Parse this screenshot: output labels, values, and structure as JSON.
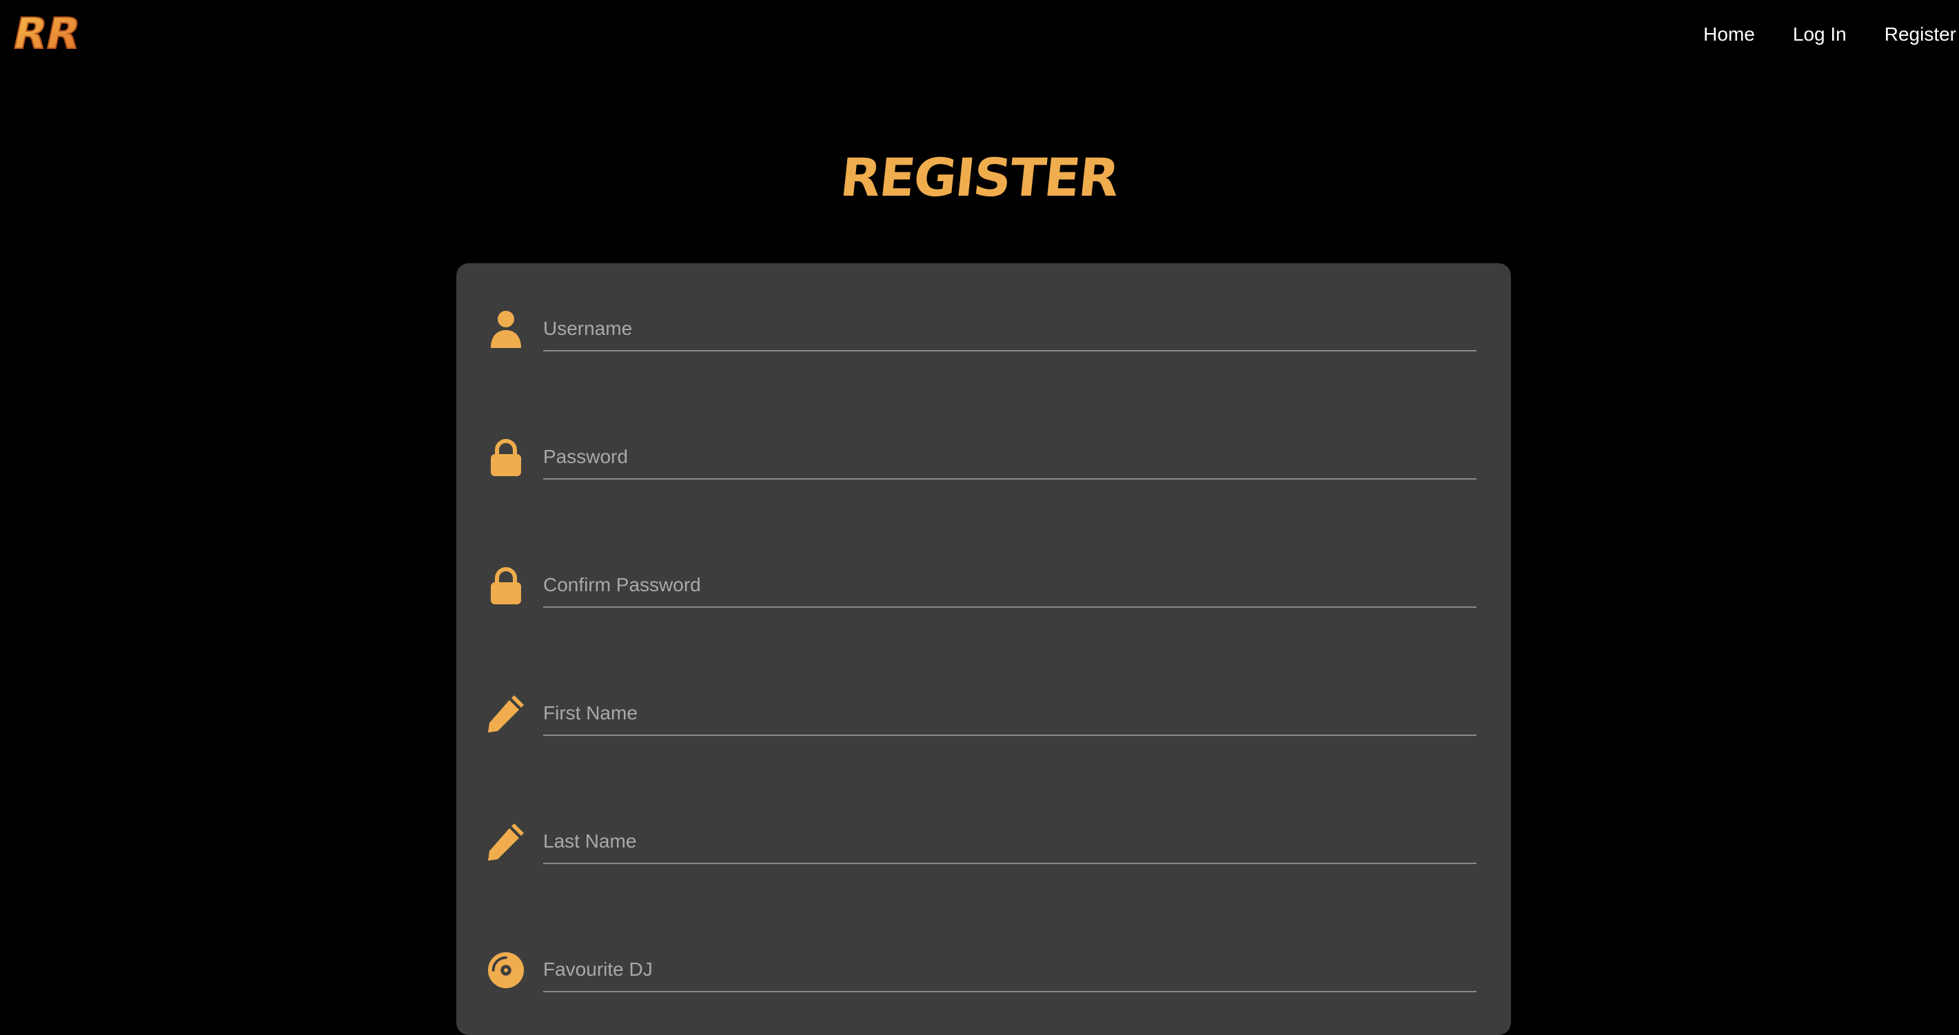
{
  "brand": {
    "logo_text": "RR",
    "accent_color": "#f0ad4e",
    "logo_color_dark": "#e0742a"
  },
  "nav": {
    "items": [
      {
        "label": "Home"
      },
      {
        "label": "Log In"
      },
      {
        "label": "Register"
      }
    ]
  },
  "page": {
    "title": "REGISTER"
  },
  "form": {
    "fields": [
      {
        "placeholder": "Username",
        "value": "",
        "icon": "user-icon"
      },
      {
        "placeholder": "Password",
        "value": "",
        "icon": "lock-icon"
      },
      {
        "placeholder": "Confirm Password",
        "value": "",
        "icon": "lock-icon"
      },
      {
        "placeholder": "First Name",
        "value": "",
        "icon": "pencil-icon"
      },
      {
        "placeholder": "Last Name",
        "value": "",
        "icon": "pencil-icon"
      },
      {
        "placeholder": "Favourite DJ",
        "value": "",
        "icon": "record-icon"
      }
    ]
  },
  "colors": {
    "background": "#000000",
    "card": "#3d3d3d",
    "underline": "#8a8a8a",
    "placeholder": "#a9a9a9"
  }
}
